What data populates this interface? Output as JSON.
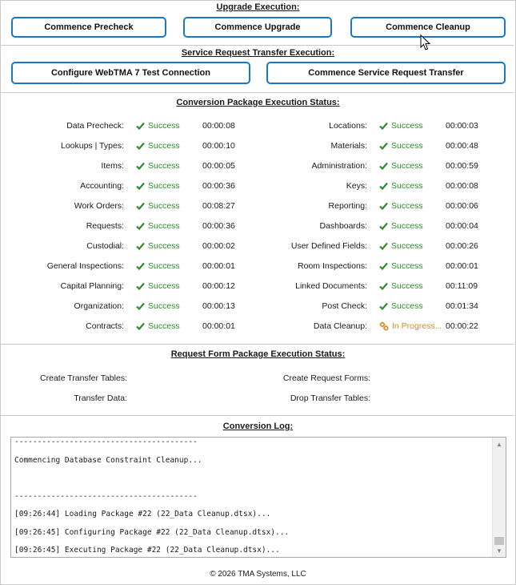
{
  "upgrade": {
    "title": "Upgrade Execution:",
    "buttons": [
      "Commence Precheck",
      "Commence Upgrade",
      "Commence Cleanup"
    ]
  },
  "transfer": {
    "title": "Service Request Transfer Execution:",
    "buttons": [
      "Configure WebTMA 7 Test Connection",
      "Commence Service Request Transfer"
    ]
  },
  "conversion": {
    "title": "Conversion Package Execution Status:",
    "left": [
      {
        "label": "Data Precheck:",
        "status": "Success",
        "time": "00:00:08"
      },
      {
        "label": "Lookups | Types:",
        "status": "Success",
        "time": "00:00:10"
      },
      {
        "label": "Items:",
        "status": "Success",
        "time": "00:00:05"
      },
      {
        "label": "Accounting:",
        "status": "Success",
        "time": "00:00:36"
      },
      {
        "label": "Work Orders:",
        "status": "Success",
        "time": "00:08:27"
      },
      {
        "label": "Requests:",
        "status": "Success",
        "time": "00:00:36"
      },
      {
        "label": "Custodial:",
        "status": "Success",
        "time": "00:00:02"
      },
      {
        "label": "General Inspections:",
        "status": "Success",
        "time": "00:00:01"
      },
      {
        "label": "Capital Planning:",
        "status": "Success",
        "time": "00:00:12"
      },
      {
        "label": "Organization:",
        "status": "Success",
        "time": "00:00:13"
      },
      {
        "label": "Contracts:",
        "status": "Success",
        "time": "00:00:01"
      }
    ],
    "right": [
      {
        "label": "Locations:",
        "status": "Success",
        "time": "00:00:03"
      },
      {
        "label": "Materials:",
        "status": "Success",
        "time": "00:00:48"
      },
      {
        "label": "Administration:",
        "status": "Success",
        "time": "00:00:59"
      },
      {
        "label": "Keys:",
        "status": "Success",
        "time": "00:00:08"
      },
      {
        "label": "Reporting:",
        "status": "Success",
        "time": "00:00:06"
      },
      {
        "label": "Dashboards:",
        "status": "Success",
        "time": "00:00:04"
      },
      {
        "label": "User Defined Fields:",
        "status": "Success",
        "time": "00:00:26"
      },
      {
        "label": "Room Inspections:",
        "status": "Success",
        "time": "00:00:01"
      },
      {
        "label": "Linked Documents:",
        "status": "Success",
        "time": "00:11:09"
      },
      {
        "label": "Post Check:",
        "status": "Success",
        "time": "00:01:34"
      },
      {
        "label": "Data Cleanup:",
        "status": "In Progress...",
        "time": "00:00:22"
      }
    ],
    "colors": {
      "success": "#2e8b2e",
      "in_progress": "#d98a1e"
    }
  },
  "request_form": {
    "title": "Request Form Package Execution Status:",
    "left": [
      "Create Transfer Tables:",
      "Transfer Data:"
    ],
    "right": [
      "Create Request Forms:",
      "Drop Transfer Tables:"
    ]
  },
  "log": {
    "title": "Conversion Log:",
    "lines": [
      "----------------------------------------",
      "Commencing Database Constraint Cleanup...",
      "",
      "----------------------------------------",
      "[09:26:44] Loading Package #22 (22_Data Cleanup.dtsx)...",
      "[09:26:45] Configuring Package #22 (22_Data Cleanup.dtsx)...",
      "[09:26:45] Executing Package #22 (22_Data Cleanup.dtsx)..."
    ]
  },
  "footer": "© 2026 TMA Systems, LLC",
  "accent_color": "#1a78c2"
}
